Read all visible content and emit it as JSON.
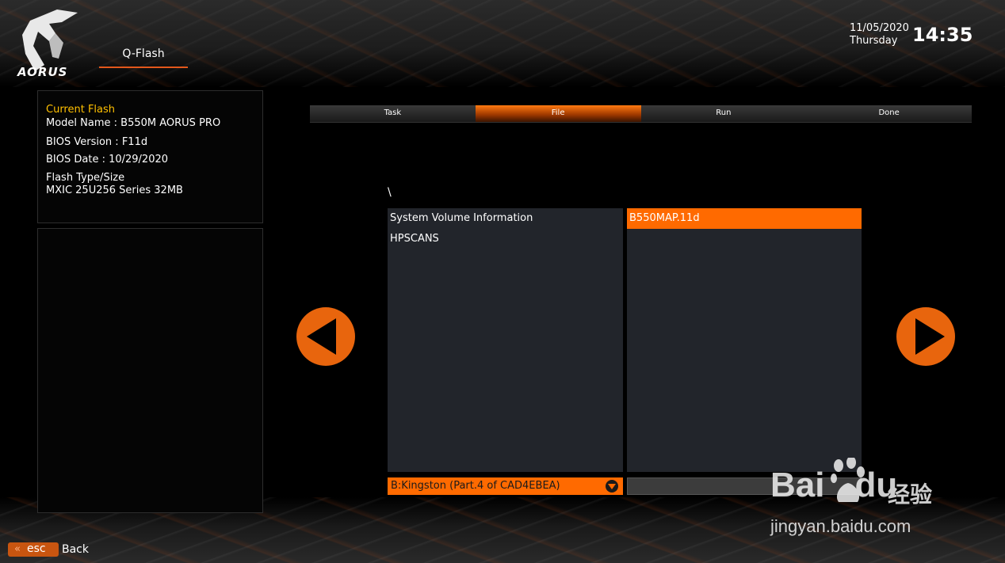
{
  "brand": {
    "logo_text": "AORUS"
  },
  "header": {
    "tab_label": "Q-Flash",
    "date": "11/05/2020",
    "weekday": "Thursday",
    "time": "14:35"
  },
  "info": {
    "heading": "Current Flash",
    "model": "Model Name : B550M AORUS PRO",
    "bios_version": "BIOS Version : F11d",
    "bios_date": "BIOS Date : 10/29/2020",
    "flash_type_label": "Flash Type/Size",
    "flash_type_value": "MXIC 25U256 Series  32MB"
  },
  "steps": [
    {
      "label": "Task",
      "active": false
    },
    {
      "label": "File",
      "active": true
    },
    {
      "label": "Run",
      "active": false
    },
    {
      "label": "Done",
      "active": false
    }
  ],
  "browser": {
    "path": "\\",
    "folders": [
      "System Volume Information",
      "HPSCANS"
    ],
    "files": [
      "B550MAP.11d"
    ],
    "selected_file": "B550MAP.11d",
    "drive": "B:Kingston (Part.4 of CAD4EBEA)"
  },
  "icons": {
    "prev": "left-triangle-icon",
    "next": "right-triangle-icon",
    "drop": "dropdown-triangle-icon",
    "esc": "double-chevron-left-icon"
  },
  "footer": {
    "esc_label": "esc",
    "back_label": "Back"
  },
  "watermark": {
    "brand": "Bai",
    "brand2": "du",
    "cn": "经验",
    "url": "jingyan.baidu.com"
  },
  "colors": {
    "accent": "#ff6a00",
    "panel": "#22252b",
    "heading": "#ffc000"
  }
}
